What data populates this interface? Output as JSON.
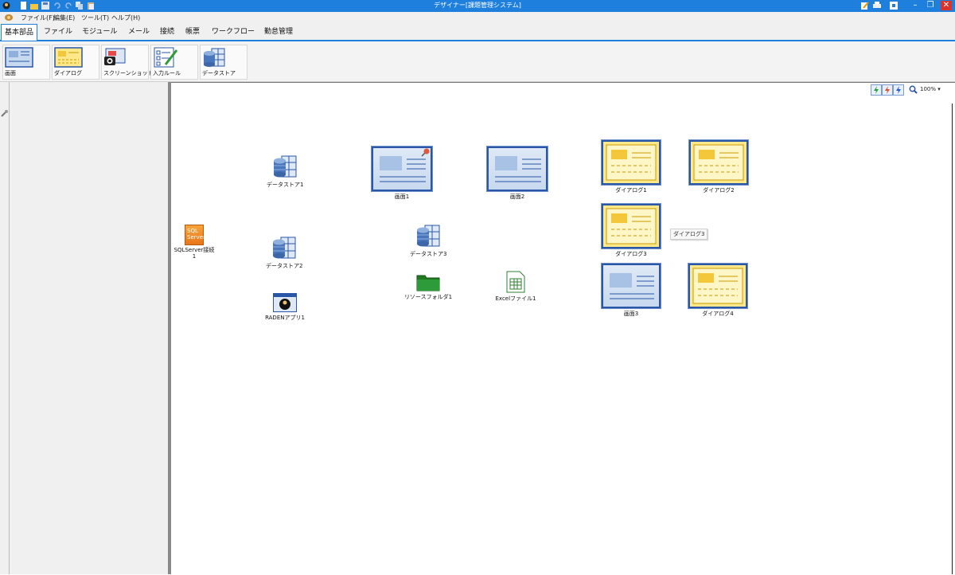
{
  "window": {
    "title": "デザイナー[課題管理システム]"
  },
  "menu": {
    "items": [
      "ファイル(F)",
      "編集(E)",
      "ツール(T)",
      "ヘルプ(H)"
    ]
  },
  "tabs": [
    "基本部品",
    "ファイル",
    "モジュール",
    "メール",
    "接続",
    "帳票",
    "ワークフロー",
    "勤怠管理"
  ],
  "ribbon": {
    "buttons": [
      "画面",
      "ダイアログ",
      "スクリーンショット",
      "入力ルール",
      "データストア"
    ]
  },
  "zoom": {
    "level": "100%"
  },
  "canvas": {
    "nodes": {
      "datastore1": "データストア1",
      "datastore2": "データストア2",
      "datastore3": "データストア3",
      "sqlserver1": "SQLServer接続",
      "sqlserver1_line2": "1",
      "raden1": "RADENアプリ1",
      "screen1": "画面1",
      "screen2": "画面2",
      "screen3": "画面3",
      "resourcefolder1": "リソースフォルダ1",
      "excel1": "Excelファイル1",
      "dialog1": "ダイアログ1",
      "dialog2": "ダイアログ2",
      "dialog3": "ダイアログ3",
      "dialog4": "ダイアログ4"
    },
    "tooltip": "ダイアログ3",
    "sql_icon_text": [
      "SQL",
      "Server"
    ]
  },
  "colors": {
    "accent": "#1e7fdc",
    "screen_border": "#2a56a8",
    "dialog_fill": "#ffe88a"
  }
}
